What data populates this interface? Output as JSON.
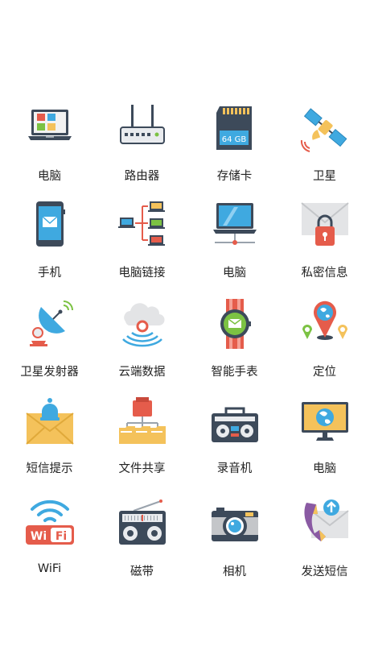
{
  "items": [
    {
      "label": "电脑",
      "icon": "laptop-icon"
    },
    {
      "label": "路由器",
      "icon": "router-icon"
    },
    {
      "label": "存储卡",
      "icon": "sd-card-icon",
      "card_text": "64 GB"
    },
    {
      "label": "卫星",
      "icon": "satellite-icon"
    },
    {
      "label": "手机",
      "icon": "smartphone-icon"
    },
    {
      "label": "电脑链接",
      "icon": "network-icon"
    },
    {
      "label": "电脑",
      "icon": "laptop-icon"
    },
    {
      "label": "私密信息",
      "icon": "private-message-icon"
    },
    {
      "label": "卫星发射器",
      "icon": "satellite-dish-icon"
    },
    {
      "label": "云端数据",
      "icon": "cloud-data-icon"
    },
    {
      "label": "智能手表",
      "icon": "smartwatch-icon"
    },
    {
      "label": "定位",
      "icon": "location-icon"
    },
    {
      "label": "短信提示",
      "icon": "message-alert-icon"
    },
    {
      "label": "文件共享",
      "icon": "file-sharing-icon"
    },
    {
      "label": "录音机",
      "icon": "recorder-icon"
    },
    {
      "label": "电脑",
      "icon": "desktop-icon"
    },
    {
      "label": "WiFi",
      "icon": "wifi-icon",
      "sign_left": "Wi",
      "sign_right": "Fi"
    },
    {
      "label": "磁带",
      "icon": "radio-icon"
    },
    {
      "label": "相机",
      "icon": "camera-icon"
    },
    {
      "label": "发送短信",
      "icon": "send-message-icon"
    }
  ],
  "colors": {
    "dark": "#3d4a5a",
    "blue": "#3fa9e0",
    "red": "#e55c4b",
    "yellow": "#f4c25b",
    "green": "#7cc243",
    "gray": "#d9dadc"
  }
}
